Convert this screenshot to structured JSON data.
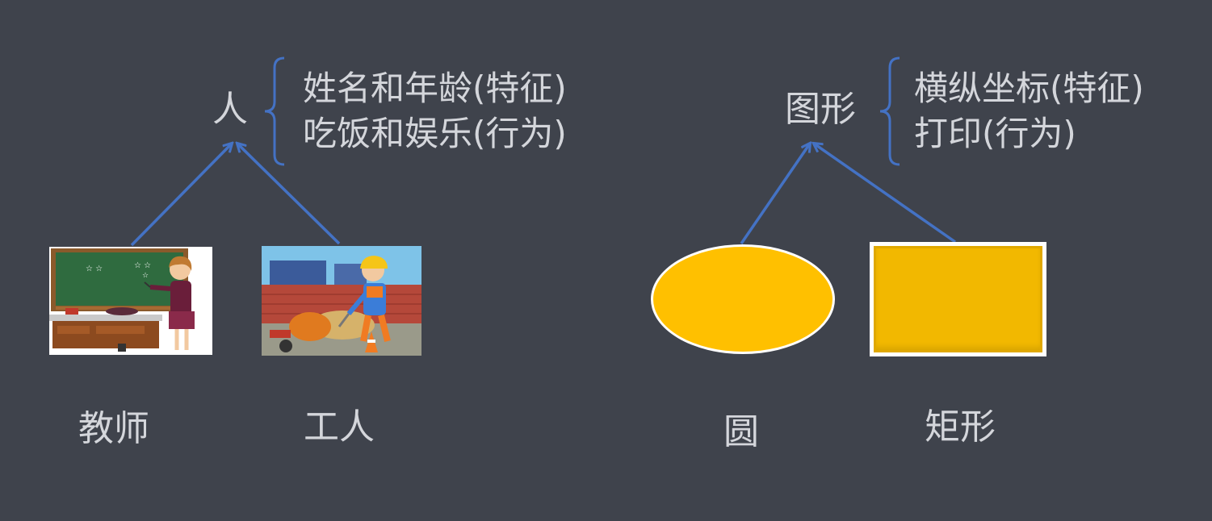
{
  "left": {
    "parent": "人",
    "attributes": [
      "姓名和年龄(特征)",
      "吃饭和娱乐(行为)"
    ],
    "children": [
      "教师",
      "工人"
    ]
  },
  "right": {
    "parent": "图形",
    "attributes": [
      "横纵坐标(特征)",
      "打印(行为)"
    ],
    "children": [
      "圆",
      "矩形"
    ]
  },
  "colors": {
    "background": "#3f434c",
    "arrow": "#4472c4",
    "shape_fill": "#ffc000",
    "text": "#d4d6db"
  },
  "icons": {
    "teacher": "teacher-illustration",
    "worker": "construction-worker-illustration"
  }
}
